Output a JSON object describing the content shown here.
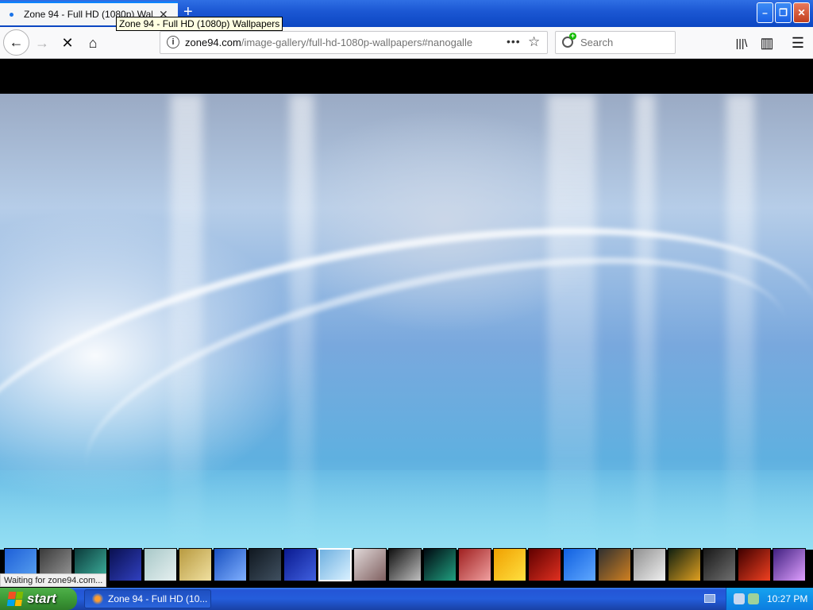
{
  "browser": {
    "tab": {
      "title": "Zone 94 - Full HD (1080p) Wallpapers",
      "close_glyph": "✕"
    },
    "new_tab_glyph": "+",
    "tooltip": "Zone 94 - Full HD (1080p) Wallpapers",
    "window_buttons": {
      "minimize": "–",
      "restore": "❐",
      "close": "✕"
    },
    "toolbar": {
      "back_glyph": "←",
      "forward_glyph": "→",
      "stop_glyph": "✕",
      "home_glyph": "⌂",
      "library_glyph": "|||\\",
      "sidebar_glyph": "▥",
      "menu_glyph": "☰"
    },
    "urlbar": {
      "info_glyph": "i",
      "host": "zone94.com",
      "path": "/image-gallery/full-hd-1080p-wallpapers#nanogalle",
      "more_glyph": "•••",
      "star_glyph": "☆"
    },
    "search": {
      "placeholder": "Search"
    },
    "status": "Waiting for zone94.com..."
  },
  "gallery": {
    "thumbnails": [
      {
        "colors": [
          "#1d5fd8",
          "#5aa2f0"
        ]
      },
      {
        "colors": [
          "#3a3a3a",
          "#9a9a9a"
        ]
      },
      {
        "colors": [
          "#0b3b3b",
          "#3fb4a0"
        ]
      },
      {
        "colors": [
          "#0a1050",
          "#3040c0"
        ]
      },
      {
        "colors": [
          "#a8c8c8",
          "#e6f0f0"
        ]
      },
      {
        "colors": [
          "#b89a40",
          "#f0e0a0"
        ]
      },
      {
        "colors": [
          "#1850c0",
          "#80b0ff"
        ]
      },
      {
        "colors": [
          "#101820",
          "#405060"
        ]
      },
      {
        "colors": [
          "#0a1a90",
          "#4060e0"
        ]
      },
      {
        "colors": [
          "#6fb0e0",
          "#d8f0ff"
        ]
      },
      {
        "colors": [
          "#e0d8d8",
          "#806060"
        ]
      },
      {
        "colors": [
          "#101010",
          "#c0c0c0"
        ]
      },
      {
        "colors": [
          "#000810",
          "#20a080"
        ]
      },
      {
        "colors": [
          "#a02020",
          "#f0a0a0"
        ]
      },
      {
        "colors": [
          "#f0a000",
          "#ffe040"
        ]
      },
      {
        "colors": [
          "#600000",
          "#e03020"
        ]
      },
      {
        "colors": [
          "#1060e0",
          "#60a8ff"
        ]
      },
      {
        "colors": [
          "#303030",
          "#d08020"
        ]
      },
      {
        "colors": [
          "#909090",
          "#f0f0f0"
        ]
      },
      {
        "colors": [
          "#102010",
          "#e0a020"
        ]
      },
      {
        "colors": [
          "#181818",
          "#707070"
        ]
      },
      {
        "colors": [
          "#400000",
          "#f04020"
        ]
      },
      {
        "colors": [
          "#402080",
          "#e0a0ff"
        ]
      }
    ],
    "selected_index": 9
  },
  "taskbar": {
    "start_label": "start",
    "task_label": "Zone 94 - Full HD (10...",
    "clock": "10:27 PM"
  }
}
